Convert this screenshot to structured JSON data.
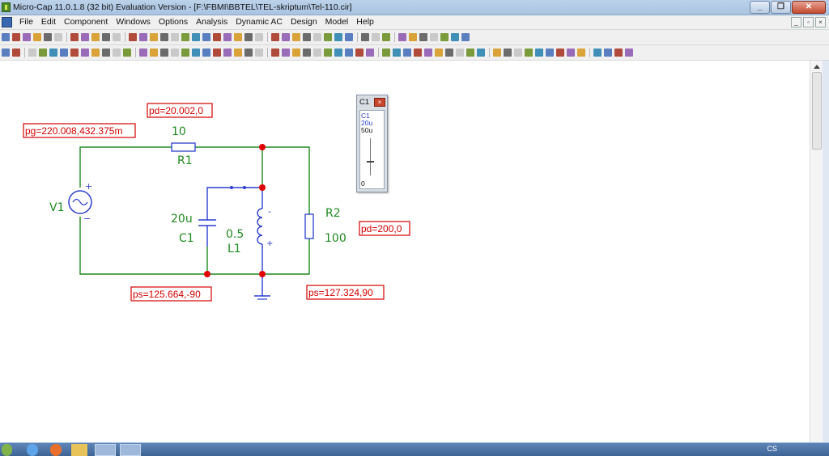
{
  "window": {
    "title": "Micro-Cap 11.0.1.8 (32 bit) Evaluation Version - [F:\\FBMI\\BBTEL\\TEL-skriptum\\Tel-110.cir]"
  },
  "menu": {
    "items": [
      "File",
      "Edit",
      "Component",
      "Windows",
      "Options",
      "Analysis",
      "Dynamic AC",
      "Design",
      "Model",
      "Help"
    ]
  },
  "toolbar": {
    "text_tool_glyph": "T",
    "font_tool_glyph": "A"
  },
  "schematic": {
    "source_label": "V1",
    "source_plus": "+",
    "source_minus": "−",
    "r1_value": "10",
    "r1_name": "R1",
    "c1_value": "20u",
    "c1_name": "C1",
    "l1_value": "0.5",
    "l1_name": "L1",
    "l1_minus": "-",
    "l1_plus": "+",
    "r2_name": "R2",
    "r2_value": "100",
    "annotations": {
      "pd_r1": "pd=20.002,0",
      "pg_v1": "pg=220.008,432.375m",
      "pd_r2": "pd=200,0",
      "ps_c1": "ps=125.664,-90",
      "ps_l1": "ps=127.324,90"
    },
    "colors": {
      "wire_green": "#1f8a1f",
      "wire_blue": "#2c3fd0",
      "node_red": "#e00000",
      "annotation_red": "#d40000"
    }
  },
  "slider": {
    "title": "C1",
    "close_glyph": "×",
    "name": "C1",
    "value": "20u",
    "max": "50u",
    "min": "0",
    "level_fraction": 0.4
  },
  "taskbar": {
    "lang": "CS"
  }
}
